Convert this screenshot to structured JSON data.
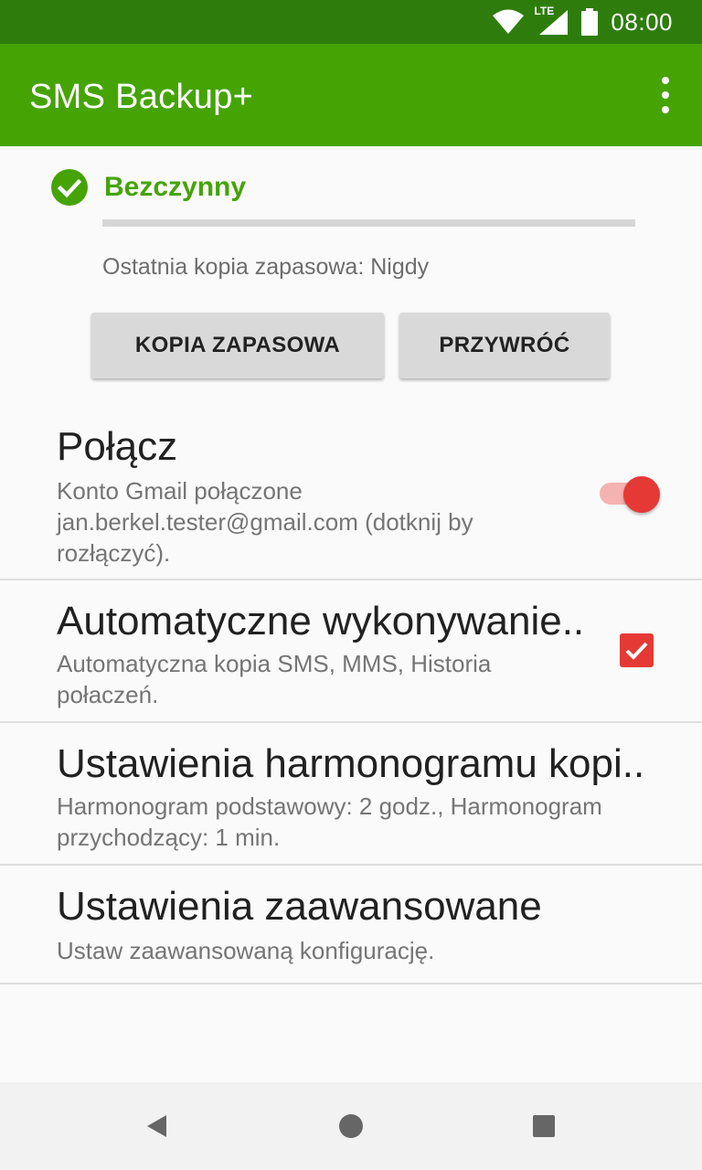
{
  "status_bar": {
    "time": "08:00",
    "network": "LTE",
    "icons": [
      "wifi-icon",
      "signal-icon",
      "battery-icon"
    ]
  },
  "app_bar": {
    "title": "SMS Backup+",
    "overflow_icon": "more-vert-icon"
  },
  "backup_status": {
    "state": "Bezczynny",
    "state_icon": "check-circle-icon",
    "progress": 0,
    "last_backup": "Ostatnia kopia zapasowa: Nigdy"
  },
  "buttons": {
    "backup": "KOPIA ZAPASOWA",
    "restore": "PRZYWRÓĆ"
  },
  "preferences": [
    {
      "title": "Połącz",
      "summary": "Konto Gmail połączone jan.berkel.tester@gmail.com (dotknij by rozłączyć).",
      "widget": "switch",
      "checked": true
    },
    {
      "title": "Automatyczne wykonywanie..",
      "summary": "Automatyczna kopia SMS, MMS, Historia połaczeń.",
      "widget": "checkbox",
      "checked": true
    },
    {
      "title": "Ustawienia harmonogramu kopi..",
      "summary": "Harmonogram podstawowy: 2 godz., Harmonogram przychodzący: 1 min."
    },
    {
      "title": "Ustawienia zaawansowane",
      "summary": "Ustaw zaawansowaną konfigurację."
    }
  ],
  "colors": {
    "primary": "#45a404",
    "primary_dark": "#2e7d0c",
    "accent": "#e53935"
  },
  "nav_bar": {
    "icons": [
      "back-icon",
      "home-icon",
      "recents-icon"
    ]
  }
}
